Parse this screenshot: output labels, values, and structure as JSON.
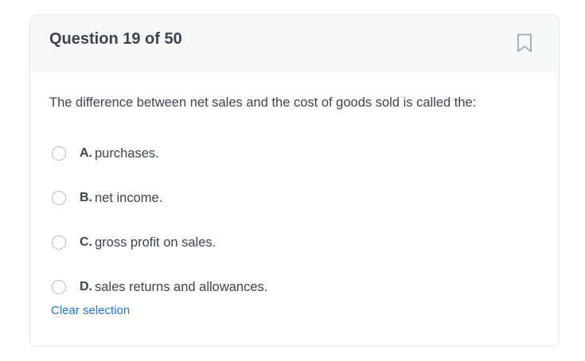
{
  "header": {
    "title": "Question 19 of 50",
    "bookmark_icon": "bookmark-icon"
  },
  "question": {
    "text": "The difference between net sales and the cost of goods sold is called the:"
  },
  "options": [
    {
      "letter": "A.",
      "text": "purchases."
    },
    {
      "letter": "B.",
      "text": "net income."
    },
    {
      "letter": "C.",
      "text": "gross profit on sales."
    },
    {
      "letter": "D.",
      "text": "sales returns and allowances."
    }
  ],
  "actions": {
    "clear_label": "Clear selection"
  },
  "colors": {
    "accent": "#1f74d4",
    "text": "#3d4451",
    "header_bg": "#f7f8fa",
    "radio_border": "#b6bcc5"
  }
}
